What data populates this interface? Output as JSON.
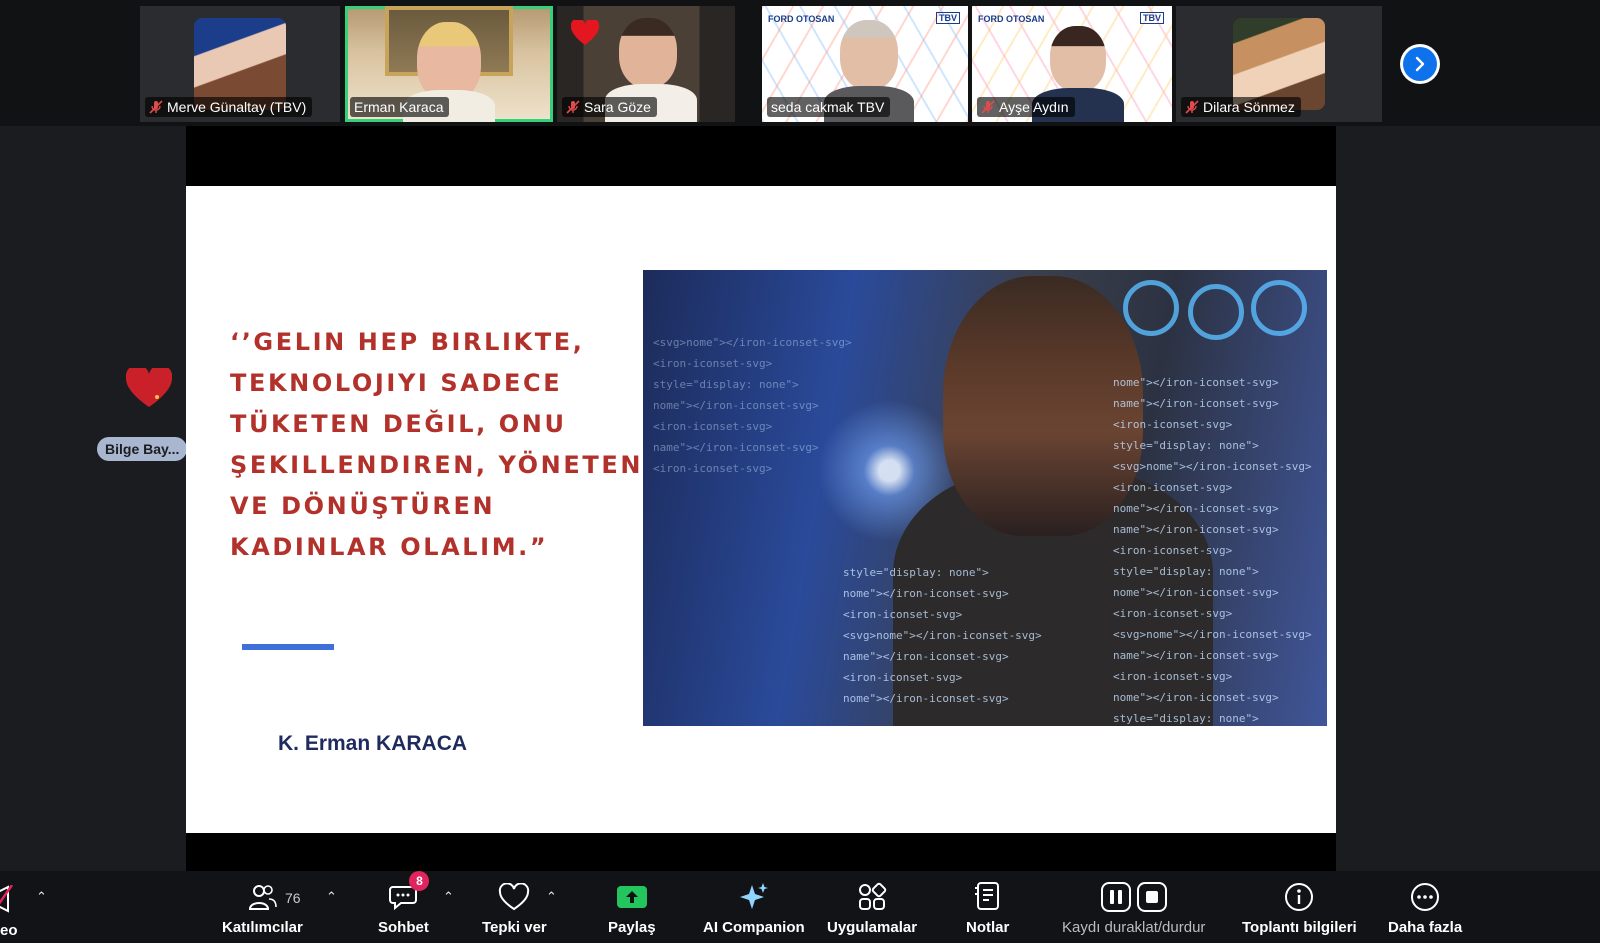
{
  "participants": [
    {
      "name": "Merve Günaltay (TBV)",
      "muted": true
    },
    {
      "name": "Erman Karaca",
      "muted": false,
      "active_speaker": true
    },
    {
      "name": "Sara Göze",
      "muted": true,
      "reaction": "heart"
    },
    {
      "name": "seda cakmak TBV",
      "muted": false
    },
    {
      "name": "Ayşe Aydın",
      "muted": true
    },
    {
      "name": "Dilara Sönmez",
      "muted": true
    }
  ],
  "tile_logos": {
    "brand": "FORD OTOSAN",
    "org": "TBV"
  },
  "slide": {
    "quote_lines": [
      "‘’GELIN HEP BIRLIKTE,",
      "TEKNOLOJIYI SADECE",
      "TÜKETEN DEĞIL, ONU",
      "ŞEKILLENDIREN, YÖNETEN",
      "VE DÖNÜŞTÜREN",
      "KADINLAR OLALIM.”"
    ],
    "author": "K. Erman KARACA",
    "code_lines": [
      "<svg>nome\"></iron-iconset-svg>",
      "nome\"></iron-iconset-svg>",
      "<iron-iconset-svg>",
      "style=\"display: none\">",
      "name\"></iron-iconset-svg>",
      "<iron-iconset-svg>"
    ]
  },
  "floating_reaction": {
    "emoji": "heart",
    "name": "Bilge Bay..."
  },
  "toolbar": {
    "left_cut_label": "eo",
    "participants": {
      "label": "Katılımcılar",
      "count": "76"
    },
    "chat": {
      "label": "Sohbet",
      "badge": "8"
    },
    "reactions": {
      "label": "Tepki ver"
    },
    "share": {
      "label": "Paylaş"
    },
    "ai": {
      "label": "AI Companion"
    },
    "apps": {
      "label": "Uygulamalar"
    },
    "notes": {
      "label": "Notlar"
    },
    "record": {
      "label": "Kaydı duraklat/durdur"
    },
    "info": {
      "label": "Toplantı bilgileri"
    },
    "more": {
      "label": "Daha fazla"
    }
  },
  "colors": {
    "active_border": "#36d07a",
    "share_green": "#22c55e",
    "quote_red": "#b2312a",
    "author_navy": "#1f2b5e",
    "accent_blue": "#3f6fd8",
    "badge_pink": "#e0245e",
    "next_blue": "#0e72ed"
  }
}
